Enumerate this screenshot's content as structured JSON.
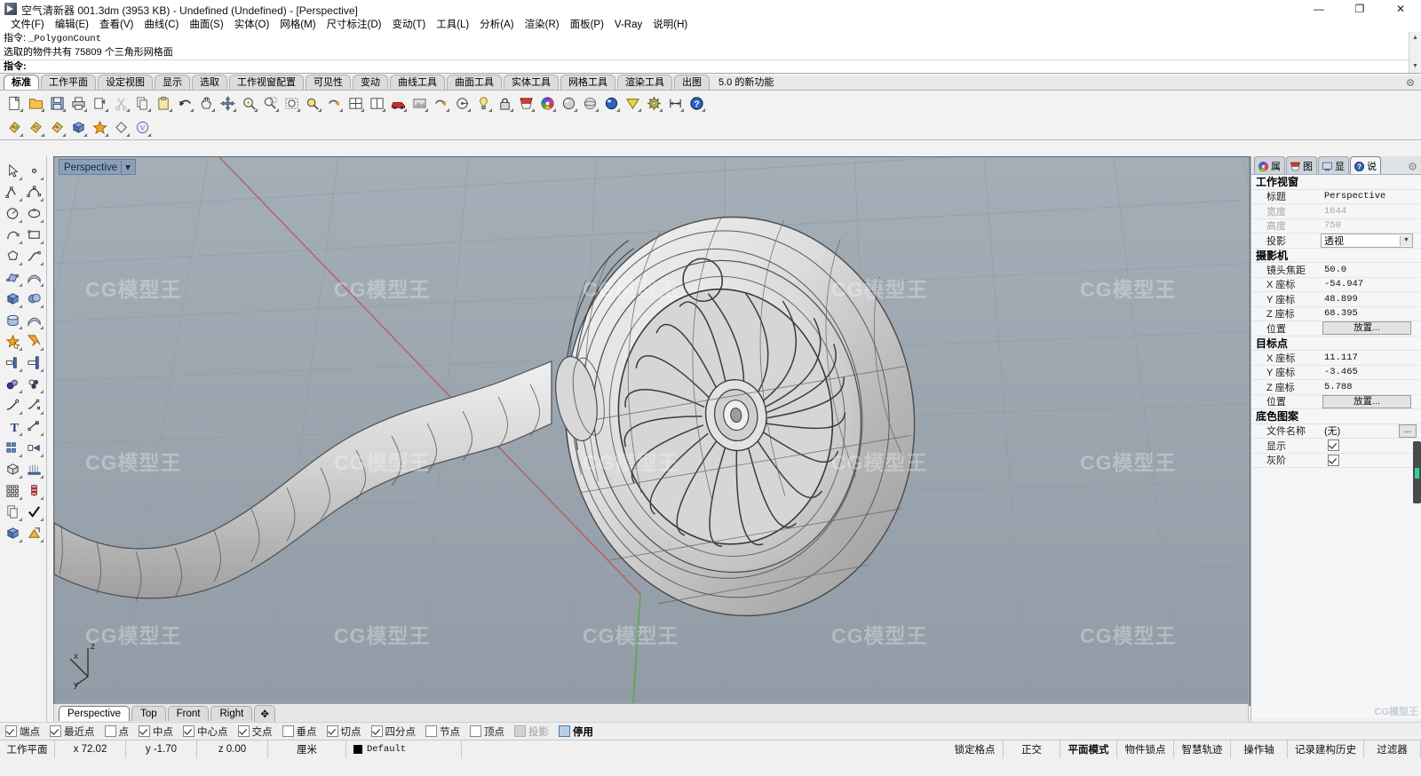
{
  "window": {
    "title": "空气清新器 001.3dm (3953 KB) - Undefined (Undefined) - [Perspective]",
    "minimize": "—",
    "maximize": "❐",
    "close": "✕"
  },
  "menu": {
    "items": [
      {
        "label": "文件(F)"
      },
      {
        "label": "编辑(E)"
      },
      {
        "label": "查看(V)"
      },
      {
        "label": "曲线(C)"
      },
      {
        "label": "曲面(S)"
      },
      {
        "label": "实体(O)"
      },
      {
        "label": "网格(M)"
      },
      {
        "label": "尺寸标注(D)"
      },
      {
        "label": "变动(T)"
      },
      {
        "label": "工具(L)"
      },
      {
        "label": "分析(A)"
      },
      {
        "label": "渲染(R)"
      },
      {
        "label": "面板(P)"
      },
      {
        "label": "V-Ray"
      },
      {
        "label": "说明(H)"
      }
    ]
  },
  "command": {
    "line1_prefix": "指令:",
    "line1_value": "_PolygonCount",
    "line2": "选取的物件共有  75809  个三角形网格面",
    "line3_prefix": "指令:",
    "line3_value": ""
  },
  "toolbar_tabs": {
    "items": [
      {
        "label": "标准",
        "active": true
      },
      {
        "label": "工作平面",
        "active": false
      },
      {
        "label": "设定视图",
        "active": false
      },
      {
        "label": "显示",
        "active": false
      },
      {
        "label": "选取",
        "active": false
      },
      {
        "label": "工作视窗配置",
        "active": false
      },
      {
        "label": "可见性",
        "active": false
      },
      {
        "label": "变动",
        "active": false
      },
      {
        "label": "曲线工具",
        "active": false
      },
      {
        "label": "曲面工具",
        "active": false
      },
      {
        "label": "实体工具",
        "active": false
      },
      {
        "label": "网格工具",
        "active": false
      },
      {
        "label": "渲染工具",
        "active": false
      },
      {
        "label": "出图",
        "active": false
      },
      {
        "label": "5.0 的新功能",
        "active": false,
        "plain": true
      }
    ]
  },
  "main_toolbar": {
    "row1": [
      {
        "icon": "new-file-icon"
      },
      {
        "icon": "open-folder-icon"
      },
      {
        "icon": "save-icon"
      },
      {
        "icon": "print-icon"
      },
      {
        "icon": "export-icon"
      },
      {
        "icon": "cut-scissors-icon"
      },
      {
        "icon": "copy-icon"
      },
      {
        "icon": "paste-icon"
      },
      {
        "icon": "undo-icon"
      },
      {
        "icon": "pan-hand-icon"
      },
      {
        "icon": "move-arrows-icon"
      },
      {
        "icon": "zoom-in-icon"
      },
      {
        "icon": "zoom-window-icon"
      },
      {
        "icon": "zoom-extents-icon"
      },
      {
        "icon": "zoom-selected-icon"
      },
      {
        "icon": "zoom-previous-icon"
      },
      {
        "icon": "viewport-4-icon"
      },
      {
        "icon": "viewport-2-icon"
      },
      {
        "icon": "car-render-icon"
      },
      {
        "icon": "render-preview-icon"
      },
      {
        "icon": "rotate-view-icon"
      },
      {
        "icon": "named-cplane-icon"
      },
      {
        "icon": "light-bulb-icon"
      },
      {
        "icon": "lock-icon"
      },
      {
        "icon": "layer-shield-icon"
      },
      {
        "icon": "color-wheel-icon"
      },
      {
        "icon": "shaded-sphere-icon"
      },
      {
        "icon": "ghosted-sphere-icon"
      },
      {
        "icon": "rendered-sphere-icon"
      },
      {
        "icon": "vray-icon"
      },
      {
        "icon": "options-gear-icon"
      },
      {
        "icon": "distance-icon"
      },
      {
        "icon": "help-icon"
      }
    ],
    "row2": [
      {
        "icon": "tag-m-icon"
      },
      {
        "icon": "tag-o-icon"
      },
      {
        "icon": "tag-f-icon"
      },
      {
        "icon": "box-blue-icon"
      },
      {
        "icon": "star-orange-icon"
      },
      {
        "icon": "diamond-icon"
      },
      {
        "icon": "v-circle-icon"
      }
    ]
  },
  "left_toolbar": {
    "items": [
      {
        "icon": "select-arrow-icon"
      },
      {
        "icon": "point-icon"
      },
      {
        "icon": "polyline-icon"
      },
      {
        "icon": "control-point-curve-icon"
      },
      {
        "icon": "circle-icon"
      },
      {
        "icon": "ellipse-icon"
      },
      {
        "icon": "arc-icon"
      },
      {
        "icon": "rectangle-icon"
      },
      {
        "icon": "polygon-icon"
      },
      {
        "icon": "curve-blend-icon"
      },
      {
        "icon": "surface-control-point-icon"
      },
      {
        "icon": "surface-loft-icon"
      },
      {
        "icon": "box-solid-icon"
      },
      {
        "icon": "sphere-solid-icon"
      },
      {
        "icon": "cylinder-solid-icon"
      },
      {
        "icon": "surface-patch-icon"
      },
      {
        "icon": "boolean-union-icon"
      },
      {
        "icon": "boolean-split-icon"
      },
      {
        "icon": "trim-icon"
      },
      {
        "icon": "split-icon"
      },
      {
        "icon": "fillet-icon"
      },
      {
        "icon": "offset-icon"
      },
      {
        "icon": "curve-from-object-icon"
      },
      {
        "icon": "extend-curve-icon"
      },
      {
        "icon": "text-icon"
      },
      {
        "icon": "dimension-icon"
      },
      {
        "icon": "group-icon"
      },
      {
        "icon": "array-linear-icon"
      },
      {
        "icon": "mesh-from-surface-icon"
      },
      {
        "icon": "mesh-tools-icon"
      },
      {
        "icon": "rectangular-array-icon"
      },
      {
        "icon": "polar-array-icon"
      },
      {
        "icon": "copy-object-icon"
      },
      {
        "icon": "check-icon"
      },
      {
        "icon": "cube-explode-icon"
      },
      {
        "icon": "render-tools-icon"
      }
    ]
  },
  "viewport": {
    "label": "Perspective",
    "dropdown_glyph": "▾",
    "watermark": "CG模型王",
    "axis": {
      "x": "x",
      "y": "y",
      "z": "z"
    },
    "bg_color": "#9aa4ad"
  },
  "viewport_tabs": {
    "items": [
      {
        "label": "Perspective",
        "active": true
      },
      {
        "label": "Top",
        "active": false
      },
      {
        "label": "Front",
        "active": false
      },
      {
        "label": "Right",
        "active": false
      },
      {
        "label": "✥",
        "active": false,
        "tiny": true
      }
    ]
  },
  "osnap": {
    "items": [
      {
        "label": "端点",
        "state": "on"
      },
      {
        "label": "最近点",
        "state": "on"
      },
      {
        "label": "点",
        "state": "off"
      },
      {
        "label": "中点",
        "state": "on"
      },
      {
        "label": "中心点",
        "state": "on"
      },
      {
        "label": "交点",
        "state": "on"
      },
      {
        "label": "垂点",
        "state": "off"
      },
      {
        "label": "切点",
        "state": "on"
      },
      {
        "label": "四分点",
        "state": "on"
      },
      {
        "label": "节点",
        "state": "off"
      },
      {
        "label": "顶点",
        "state": "off"
      },
      {
        "label": "投影",
        "state": "disabled"
      },
      {
        "label": "停用",
        "state": "highlight"
      }
    ]
  },
  "statusbar": {
    "cplane_label": "工作平面",
    "x_label": "x 72.02",
    "y_label": "y -1.70",
    "z_label": "z 0.00",
    "units": "厘米",
    "layer": "Default",
    "layer_color": "#000000",
    "toggles": [
      {
        "label": "锁定格点",
        "bold": false
      },
      {
        "label": "正交",
        "bold": false
      },
      {
        "label": "平面模式",
        "bold": true
      },
      {
        "label": "物件锁点",
        "bold": false
      },
      {
        "label": "智慧轨迹",
        "bold": false
      },
      {
        "label": "操作轴",
        "bold": false
      },
      {
        "label": "记录建构历史",
        "bold": false
      },
      {
        "label": "过滤器",
        "bold": false
      }
    ]
  },
  "properties": {
    "tabs": [
      {
        "label": "属",
        "icon": "color-wheel-icon",
        "active": false
      },
      {
        "label": "图",
        "icon": "layer-shield-icon",
        "active": false
      },
      {
        "label": "显",
        "icon": "display-monitor-icon",
        "active": false
      },
      {
        "label": "说",
        "icon": "help-note-icon",
        "active": true
      }
    ],
    "gear_icon": "gear-icon",
    "sections": [
      {
        "title": "工作视窗",
        "rows": [
          {
            "label": "标题",
            "value": "Perspective",
            "type": "text"
          },
          {
            "label": "宽度",
            "value": "1644",
            "type": "text",
            "dim": true
          },
          {
            "label": "高度",
            "value": "750",
            "type": "text",
            "dim": true
          },
          {
            "label": "投影",
            "value": "透视",
            "type": "combo"
          }
        ]
      },
      {
        "title": "摄影机",
        "rows": [
          {
            "label": "镜头焦距",
            "value": "50.0",
            "type": "text"
          },
          {
            "label": "X 座标",
            "value": "-54.947",
            "type": "text"
          },
          {
            "label": "Y 座标",
            "value": "48.899",
            "type": "text"
          },
          {
            "label": "Z 座标",
            "value": "68.395",
            "type": "text"
          },
          {
            "label": "位置",
            "value": "放置...",
            "type": "button"
          }
        ]
      },
      {
        "title": "目标点",
        "rows": [
          {
            "label": "X 座标",
            "value": "11.117",
            "type": "text"
          },
          {
            "label": "Y 座标",
            "value": "-3.465",
            "type": "text"
          },
          {
            "label": "Z 座标",
            "value": "5.788",
            "type": "text"
          },
          {
            "label": "位置",
            "value": "放置...",
            "type": "button"
          }
        ]
      },
      {
        "title": "底色图案",
        "rows": [
          {
            "label": "文件名称",
            "value": "(无)",
            "type": "file"
          },
          {
            "label": "显示",
            "value": "",
            "type": "check"
          },
          {
            "label": "灰阶",
            "value": "",
            "type": "check"
          }
        ]
      }
    ]
  }
}
